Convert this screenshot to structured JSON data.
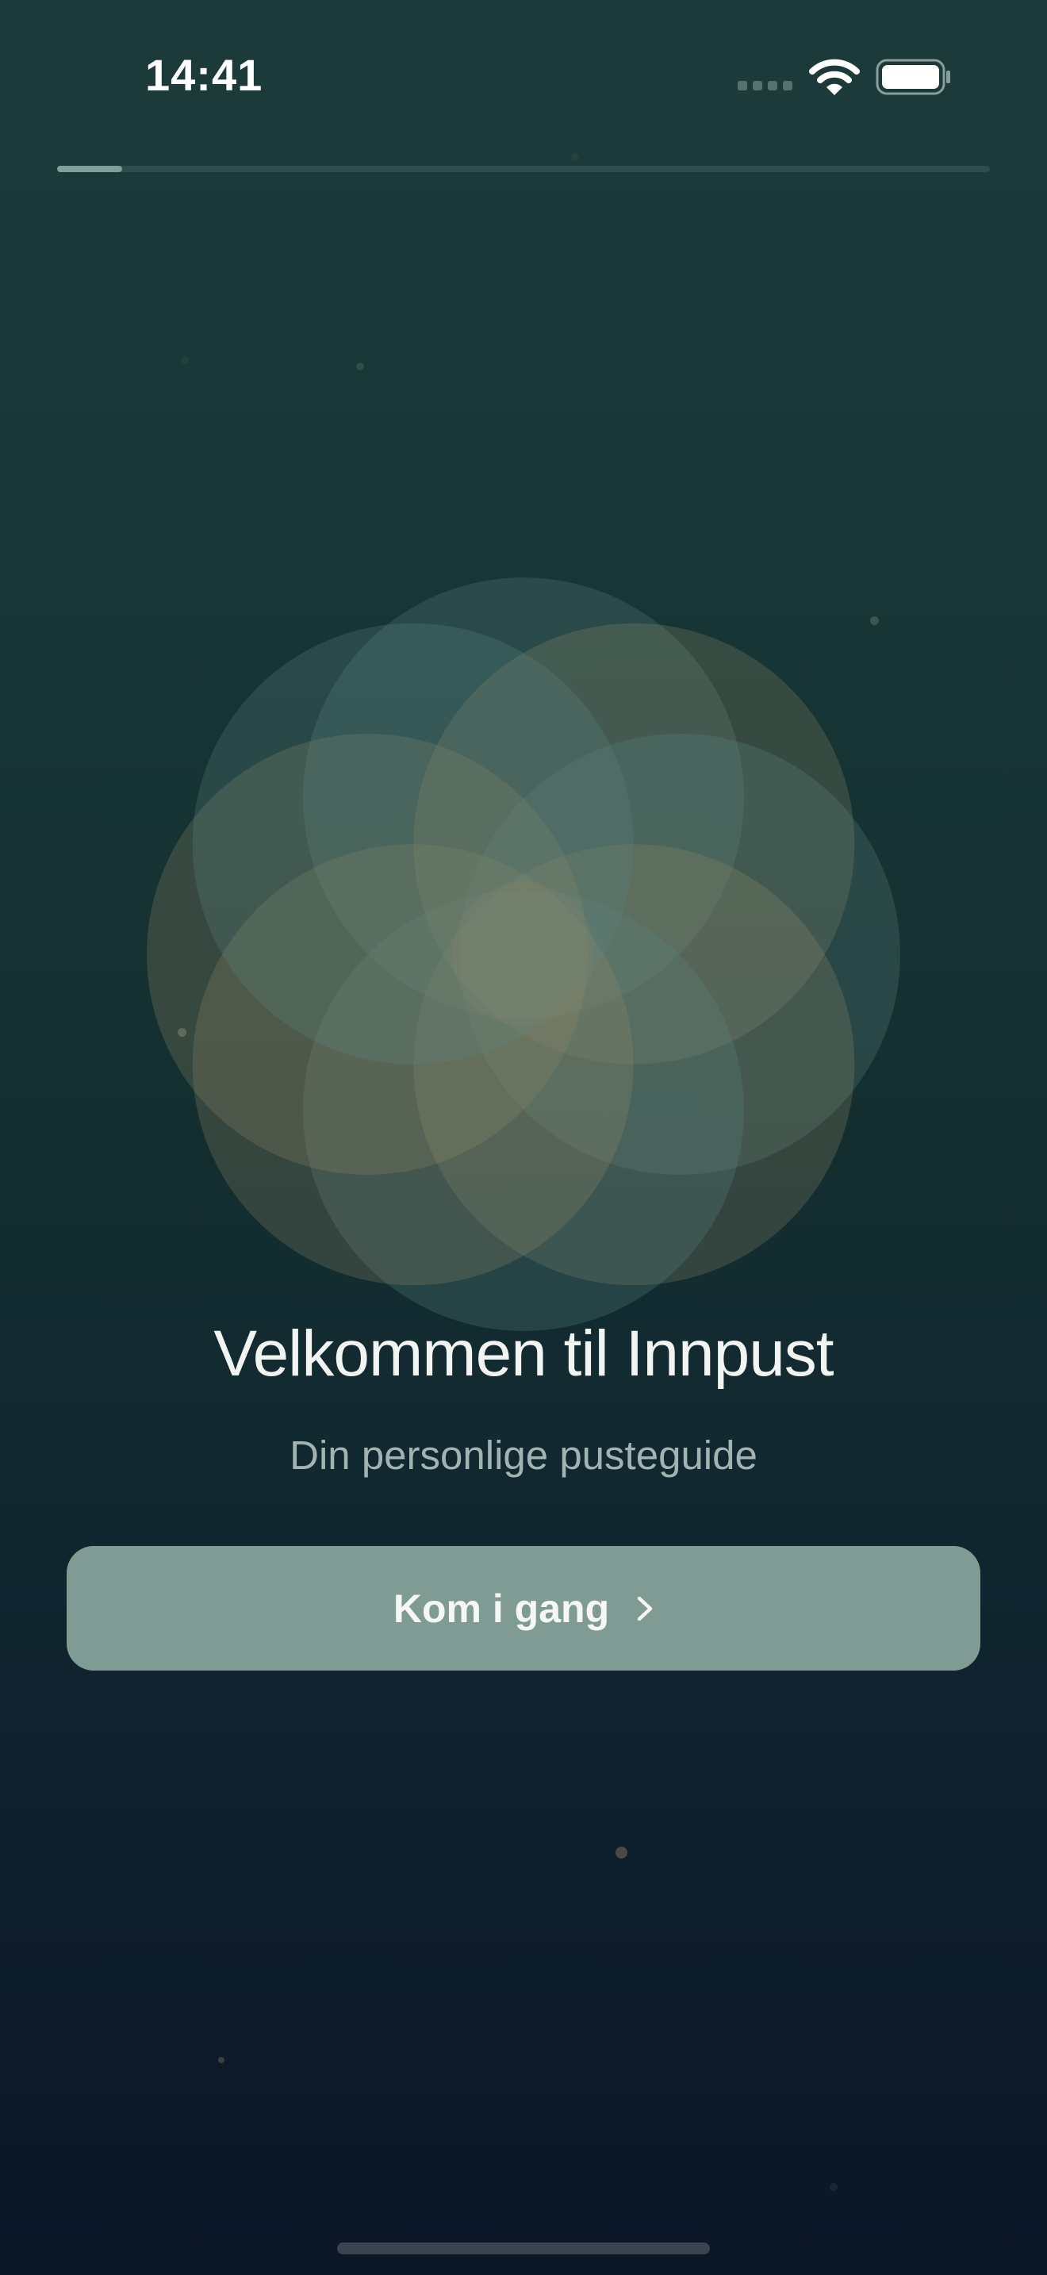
{
  "status_bar": {
    "time": "14:41",
    "icons": [
      "signal-dots-icon",
      "wifi-icon",
      "battery-icon"
    ]
  },
  "onboarding": {
    "progress": 0.07,
    "title": "Velkommen til Innpust",
    "subtitle": "Din personlige pusteguide",
    "cta_label": "Kom i gang",
    "cta_icon": "chevron-right-icon"
  },
  "colors": {
    "background_top": "#1d3b3b",
    "background_bottom": "#0b1627",
    "button": "#809b93",
    "progress_fill": "#7f9f99",
    "petal_teal": "#5e8583",
    "petal_sand": "#8f8768"
  }
}
